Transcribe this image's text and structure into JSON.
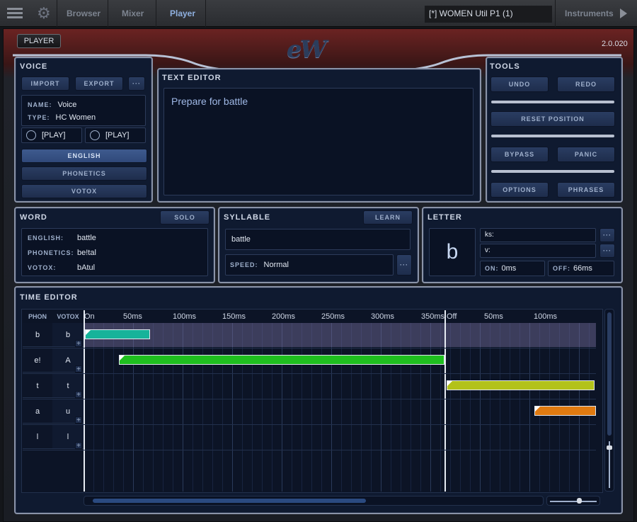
{
  "topbar": {
    "browser": "Browser",
    "mixer": "Mixer",
    "player": "Player",
    "preset": "[*] WOMEN Util P1 (1)",
    "instruments": "Instruments"
  },
  "header": {
    "player_button": "PLAYER",
    "logo": "eW",
    "version": "2.0.020"
  },
  "voice": {
    "title": "VOICE",
    "import": "IMPORT",
    "export": "EXPORT",
    "more": "···",
    "name_label": "NAME:",
    "name": "Voice",
    "type_label": "TYPE:",
    "type": "HC Women",
    "play1": "[PLAY]",
    "play2": "[PLAY]",
    "modes": [
      "ENGLISH",
      "PHONETICS",
      "VOTOX"
    ]
  },
  "text_editor": {
    "title": "TEXT EDITOR",
    "text": "Prepare for battle"
  },
  "tools": {
    "title": "TOOLS",
    "undo": "UNDO",
    "redo": "REDO",
    "reset": "RESET POSITION",
    "bypass": "BYPASS",
    "panic": "PANIC",
    "options": "OPTIONS",
    "phrases": "PHRASES"
  },
  "word": {
    "title": "WORD",
    "solo": "SOLO",
    "english_label": "ENGLISH:",
    "english": "battle",
    "phonetics_label": "PHONETICS:",
    "phonetics": "be!tal",
    "votox_label": "VOTOX:",
    "votox": "bAtul"
  },
  "syllable": {
    "title": "SYLLABLE",
    "learn": "LEARN",
    "value": "battle",
    "speed_label": "SPEED:",
    "speed": "Normal",
    "more": "···"
  },
  "letter": {
    "title": "LETTER",
    "value": "b",
    "ks_label": "ks:",
    "v_label": "v:",
    "more": "···",
    "on_label": "ON:",
    "on": "0ms",
    "off_label": "OFF:",
    "off": "66ms"
  },
  "time_editor": {
    "title": "TIME EDITOR",
    "phon_header": "PHON",
    "votox_header": "VOTOX",
    "ticks": [
      "On",
      "50ms",
      "100ms",
      "150ms",
      "200ms",
      "250ms",
      "300ms",
      "350ms",
      "Off",
      "50ms",
      "100ms"
    ],
    "rows": [
      {
        "phon": "b",
        "votox": "b",
        "color": "#16b39a"
      },
      {
        "phon": "e!",
        "votox": "A",
        "color": "#1fbf1f"
      },
      {
        "phon": "t",
        "votox": "t",
        "color": "#b3c21a"
      },
      {
        "phon": "a",
        "votox": "u",
        "color": "#e07a10"
      },
      {
        "phon": "l",
        "votox": "l",
        "color": ""
      }
    ]
  }
}
